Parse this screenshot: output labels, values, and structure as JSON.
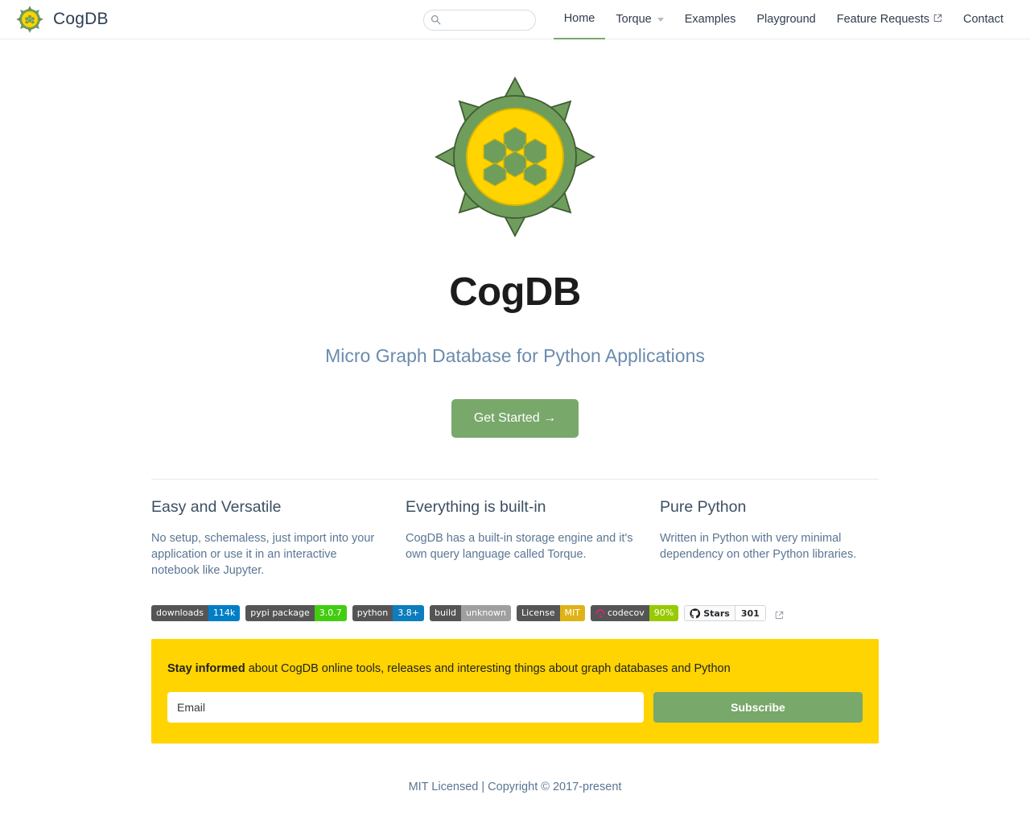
{
  "header": {
    "brand": "CogDB",
    "logo_icon": "cog-hex-logo",
    "search": {
      "placeholder": "",
      "value": "",
      "icon": "search-icon"
    },
    "nav": [
      {
        "label": "Home",
        "active": true,
        "dropdown": false,
        "external": false
      },
      {
        "label": "Torque",
        "active": false,
        "dropdown": true,
        "external": false
      },
      {
        "label": "Examples",
        "active": false,
        "dropdown": false,
        "external": false
      },
      {
        "label": "Playground",
        "active": false,
        "dropdown": false,
        "external": false
      },
      {
        "label": "Feature Requests",
        "active": false,
        "dropdown": false,
        "external": true
      },
      {
        "label": "Contact",
        "active": false,
        "dropdown": false,
        "external": false
      }
    ]
  },
  "hero": {
    "logo_icon": "cog-hex-logo-large",
    "title": "CogDB",
    "tagline": "Micro Graph Database for Python Applications",
    "cta_label": "Get Started →"
  },
  "features": [
    {
      "title": "Easy and Versatile",
      "body": "No setup, schemaless, just import into your application or use it in an interactive notebook like Jupyter."
    },
    {
      "title": "Everything is built-in",
      "body": "CogDB has a built-in storage engine and it's own query language called Torque."
    },
    {
      "title": "Pure Python",
      "body": "Written in Python with very minimal dependency on other Python libraries."
    }
  ],
  "badges": [
    {
      "label": "downloads",
      "value": "114k",
      "label_color": "#555555",
      "value_color": "#007ec6",
      "icon": null
    },
    {
      "label": "pypi package",
      "value": "3.0.7",
      "label_color": "#555555",
      "value_color": "#44cc11",
      "icon": null
    },
    {
      "label": "python",
      "value": "3.8+",
      "label_color": "#555555",
      "value_color": "#0d7dbe",
      "icon": null
    },
    {
      "label": "build",
      "value": "unknown",
      "label_color": "#555555",
      "value_color": "#9f9f9f",
      "icon": null
    },
    {
      "label": "License",
      "value": "MIT",
      "label_color": "#555555",
      "value_color": "#dfb317",
      "icon": null
    },
    {
      "label": "codecov",
      "value": "90%",
      "label_color": "#555555",
      "value_color": "#97ca00",
      "icon": "umbrella-icon"
    }
  ],
  "stars_badge": {
    "label": "Stars",
    "value": "301",
    "icon": "github-icon",
    "external_icon": "external-link-icon"
  },
  "newsletter": {
    "bold_text": "Stay informed",
    "rest_text": " about CogDB online tools, releases and interesting things about graph databases and Python",
    "email_placeholder": "Email",
    "email_value": "",
    "subscribe_label": "Subscribe",
    "bg_color": "#ffd400",
    "button_color": "#79a86b"
  },
  "footer": {
    "text": "MIT Licensed | Copyright © 2017-present"
  }
}
